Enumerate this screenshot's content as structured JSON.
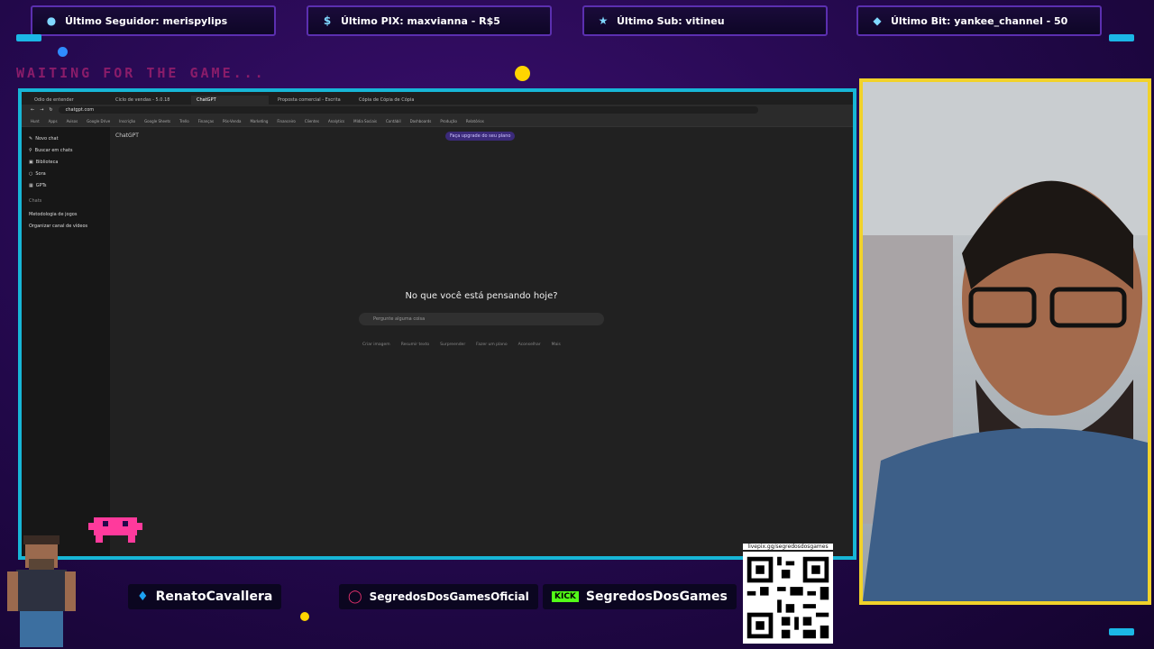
{
  "alerts": [
    {
      "label": "Último Seguidor: merispylips",
      "icon": "user-icon"
    },
    {
      "label": "Último PIX: maxvianna - R$5",
      "icon": "dollar-icon"
    },
    {
      "label": "Último Sub: vitineu",
      "icon": "star-icon"
    },
    {
      "label": "Último Bit: yankee_channel - 50",
      "icon": "diamond-icon"
    }
  ],
  "overlay": {
    "waiting_text": "WAITING FOR THE GAME..."
  },
  "browser": {
    "tabs": [
      "Odio de entender",
      "Ciclo de vendas - 5.0.18",
      "ChatGPT",
      "Proposta comercial - Escrita",
      "Cópia de Cópia de Cópia"
    ],
    "url": "chatgpt.com",
    "bookmarks": [
      "Hunt",
      "Apps",
      "Avisos",
      "Google Drive",
      "Inscrição",
      "Google Sheets",
      "Trello",
      "Finanças",
      "Pós-Venda",
      "Marketing",
      "Financeiro",
      "Clientes",
      "Analytics",
      "Mídia Sociais",
      "Contábil",
      "Dashboards",
      "Produção",
      "Relatórios"
    ]
  },
  "chatgpt": {
    "sidebar": [
      "Novo chat",
      "Buscar em chats",
      "Biblioteca",
      "Sora",
      "GPTs"
    ],
    "section": "Chats",
    "chats": [
      "Metodologia de jogos",
      "Organizar canal de vídeos"
    ],
    "model": "ChatGPT",
    "plan_button": "Faça upgrade do seu plano",
    "hero": "No que você está pensando hoje?",
    "prompt_placeholder": "Pergunte alguma coisa",
    "chips": [
      "Criar imagem",
      "Resumir texto",
      "Surpreender",
      "Fazer um plano",
      "Aconselhar",
      "Mais"
    ]
  },
  "socials": {
    "twitter": "RenatoCavallera",
    "instagram": "SegredosDosGamesOficial",
    "kick_badge": "KICK",
    "kick": "SegredosDosGames"
  },
  "qr": {
    "label": "livepix.gg/segredosdosgames"
  },
  "colors": {
    "frame": "#17b6d6",
    "cam_border": "#f1d22a",
    "bg": "#22084a"
  }
}
